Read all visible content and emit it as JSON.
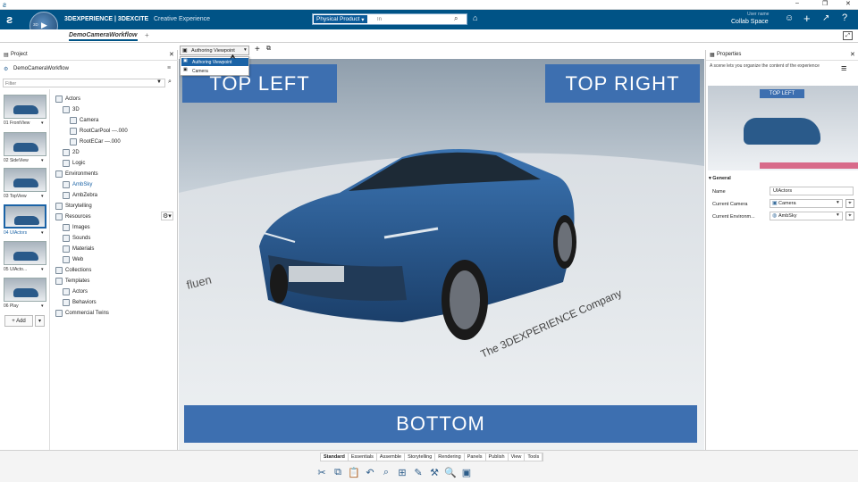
{
  "titlebar": {
    "win_min": "–",
    "win_max": "❐",
    "win_close": "✕"
  },
  "topbar": {
    "brand_bold": "3DEXPERIENCE | 3DEXCITE",
    "brand_light": "Creative Experience",
    "compass_version": "V.R",
    "search_scope": "Physical Product",
    "search_placeholder": "In",
    "user_label": "User name",
    "user_space": "Collab Space"
  },
  "tabs": {
    "active": "DemoCameraWorkflow",
    "add": "+"
  },
  "viewpoint": {
    "selected": "Authoring Viewpoint",
    "options": [
      "Authoring Viewpoint",
      "Camera"
    ]
  },
  "leftpanel": {
    "tab": "Project",
    "root": "DemoCameraWorkflow",
    "filter_placeholder": "Filter",
    "thumbs": [
      {
        "label": "01  FrontView"
      },
      {
        "label": "02  SideView"
      },
      {
        "label": "03  TopView"
      },
      {
        "label": "04  UIActors"
      },
      {
        "label": "05  UIActo..."
      },
      {
        "label": "06  Play"
      }
    ],
    "add_label": "+ Add",
    "tree": [
      {
        "label": "Actors",
        "indent": 0
      },
      {
        "label": "3D",
        "indent": 1
      },
      {
        "label": "Camera",
        "indent": 2
      },
      {
        "label": "RootCarPool ---.000",
        "indent": 2
      },
      {
        "label": "RootECar ---.000",
        "indent": 2
      },
      {
        "label": "2D",
        "indent": 1
      },
      {
        "label": "Logic",
        "indent": 1
      },
      {
        "label": "Environments",
        "indent": 0
      },
      {
        "label": "AmbSky",
        "indent": 1
      },
      {
        "label": "AmbZebra",
        "indent": 1
      },
      {
        "label": "Storytelling",
        "indent": 0
      },
      {
        "label": "Resources",
        "indent": 0
      },
      {
        "label": "Images",
        "indent": 1
      },
      {
        "label": "Sounds",
        "indent": 1
      },
      {
        "label": "Materials",
        "indent": 1
      },
      {
        "label": "Web",
        "indent": 1
      },
      {
        "label": "Collections",
        "indent": 0
      },
      {
        "label": "Templates",
        "indent": 0
      },
      {
        "label": "Actors",
        "indent": 1
      },
      {
        "label": "Behaviors",
        "indent": 1
      },
      {
        "label": "Commercial Twins",
        "indent": 0
      }
    ]
  },
  "viewport": {
    "top_left": "TOP LEFT",
    "top_right": "TOP RIGHT",
    "bottom": "BOTTOM",
    "floor_text": "The 3DEXPERIENCE Company",
    "floor_text2": "fluen"
  },
  "properties": {
    "tab": "Properties",
    "desc": "A scene lets you organize the content of the experience",
    "preview_label": "TOP LEFT",
    "section": "General",
    "name_label": "Name",
    "name_value": "UIActors",
    "camera_label": "Current Camera",
    "camera_value": "Camera",
    "env_label": "Current Environm...",
    "env_value": "AmbSky"
  },
  "bottom_tabs": [
    "Standard",
    "Essentials",
    "Assemble",
    "Storytelling",
    "Rendering",
    "Panels",
    "Publish",
    "View",
    "Tools"
  ],
  "colors": {
    "accent": "#005386",
    "banner": "#3d6fb0"
  }
}
